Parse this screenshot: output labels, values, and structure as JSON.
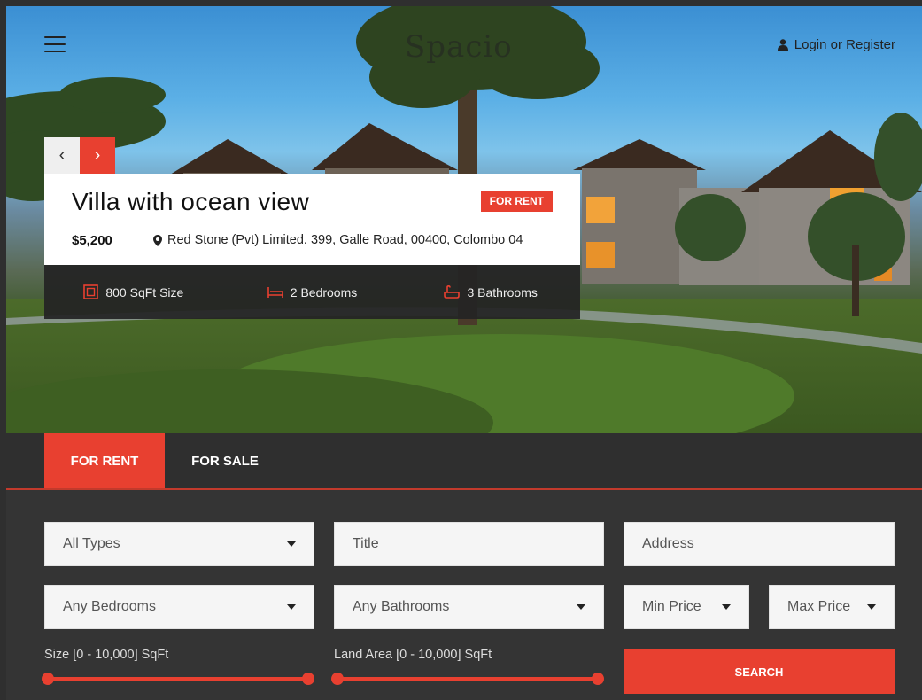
{
  "header": {
    "logo": "Spacio",
    "login_label": "Login or Register"
  },
  "listing": {
    "title": "Villa with ocean view",
    "badge": "FOR RENT",
    "price": "$5,200",
    "address": "Red Stone (Pvt) Limited. 399, Galle Road, 00400, Colombo 04",
    "stats": {
      "size": "800 SqFt Size",
      "bedrooms": "2 Bedrooms",
      "bathrooms": "3 Bathrooms"
    }
  },
  "tabs": {
    "rent": "FOR RENT",
    "sale": "FOR SALE"
  },
  "search": {
    "type_select": "All Types",
    "title_placeholder": "Title",
    "address_placeholder": "Address",
    "bedrooms_select": "Any Bedrooms",
    "bathrooms_select": "Any Bathrooms",
    "min_price_select": "Min Price",
    "max_price_select": "Max Price",
    "size_label": "Size [0 - 10,000] SqFt",
    "land_label": "Land Area [0 - 10,000] SqFt",
    "button": "SEARCH"
  },
  "colors": {
    "accent": "#e84030",
    "dark": "#2f2f2f"
  },
  "icons": [
    "menu-icon",
    "user-icon",
    "chevron-left-icon",
    "chevron-right-icon",
    "map-marker-icon",
    "size-icon",
    "bed-icon",
    "bath-icon",
    "caret-down-icon"
  ]
}
